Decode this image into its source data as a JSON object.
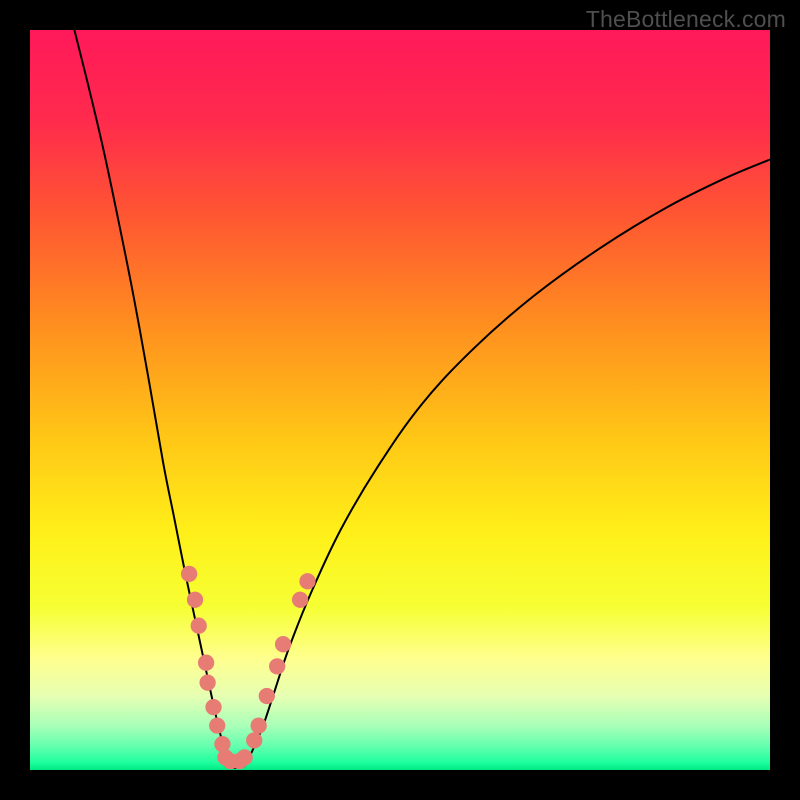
{
  "watermark": "TheBottleneck.com",
  "colors": {
    "gradient_stops": [
      {
        "offset": 0.0,
        "color": "#ff195a"
      },
      {
        "offset": 0.12,
        "color": "#ff2a4d"
      },
      {
        "offset": 0.25,
        "color": "#ff5632"
      },
      {
        "offset": 0.4,
        "color": "#ff8f1f"
      },
      {
        "offset": 0.55,
        "color": "#ffc616"
      },
      {
        "offset": 0.68,
        "color": "#fff019"
      },
      {
        "offset": 0.78,
        "color": "#f6ff34"
      },
      {
        "offset": 0.85,
        "color": "#ffff8f"
      },
      {
        "offset": 0.9,
        "color": "#e6ffb2"
      },
      {
        "offset": 0.94,
        "color": "#aaffb9"
      },
      {
        "offset": 0.97,
        "color": "#5dffad"
      },
      {
        "offset": 0.99,
        "color": "#1eff9e"
      },
      {
        "offset": 1.0,
        "color": "#00e884"
      }
    ],
    "dot_fill": "#e77c74",
    "curve_stroke": "#000000",
    "frame": "#000000"
  },
  "chart_data": {
    "type": "line",
    "title": "",
    "xlabel": "",
    "ylabel": "",
    "xlim": [
      0,
      100
    ],
    "ylim": [
      0,
      100
    ],
    "grid": false,
    "series": [
      {
        "name": "left-curve",
        "x": [
          6,
          8,
          10,
          12,
          14,
          16,
          18,
          19.5,
          21,
          22.5,
          24,
          25.2,
          26.2,
          27
        ],
        "y": [
          100,
          92,
          83.5,
          74,
          64,
          53,
          41.5,
          34,
          26.5,
          19.5,
          12.5,
          7,
          3,
          0.5
        ]
      },
      {
        "name": "right-curve",
        "x": [
          29,
          30,
          31.5,
          33,
          35,
          38,
          42,
          47,
          53,
          60,
          68,
          77,
          86,
          94,
          100
        ],
        "y": [
          0.5,
          2.5,
          6,
          10.5,
          16.5,
          24,
          32.5,
          41,
          49.5,
          57,
          64,
          70.5,
          76,
          80,
          82.5
        ]
      },
      {
        "name": "valley-floor",
        "x": [
          27,
          27.5,
          28,
          28.5,
          29
        ],
        "y": [
          0.5,
          0.3,
          0.3,
          0.3,
          0.5
        ]
      }
    ],
    "points": [
      {
        "x": 21.5,
        "y": 26.5
      },
      {
        "x": 22.3,
        "y": 23.0
      },
      {
        "x": 22.8,
        "y": 19.5
      },
      {
        "x": 23.8,
        "y": 14.5
      },
      {
        "x": 24.0,
        "y": 11.8
      },
      {
        "x": 24.8,
        "y": 8.5
      },
      {
        "x": 25.3,
        "y": 6.0
      },
      {
        "x": 26.0,
        "y": 3.5
      },
      {
        "x": 26.4,
        "y": 1.7
      },
      {
        "x": 27.1,
        "y": 1.2
      },
      {
        "x": 28.3,
        "y": 1.2
      },
      {
        "x": 29.0,
        "y": 1.7
      },
      {
        "x": 30.3,
        "y": 4.0
      },
      {
        "x": 30.9,
        "y": 6.0
      },
      {
        "x": 32.0,
        "y": 10.0
      },
      {
        "x": 33.4,
        "y": 14.0
      },
      {
        "x": 34.2,
        "y": 17.0
      },
      {
        "x": 36.5,
        "y": 23.0
      },
      {
        "x": 37.5,
        "y": 25.5
      }
    ],
    "dot_radius": 1.1
  }
}
